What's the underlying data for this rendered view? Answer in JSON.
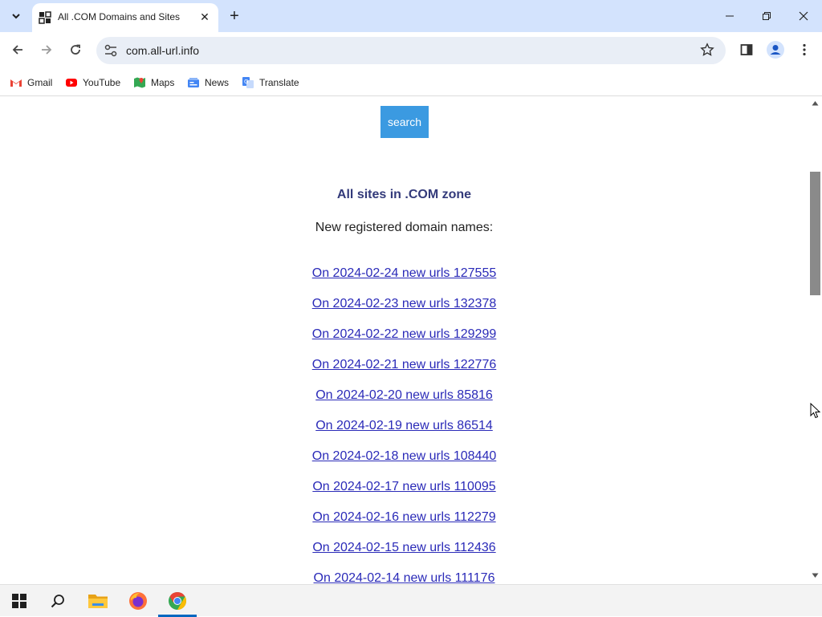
{
  "browser": {
    "tab": {
      "title": "All .COM Domains and Sites",
      "close": "✕"
    },
    "new_tab": "+",
    "window": {
      "minimize": "—",
      "restore": "❐",
      "close": "✕"
    },
    "url": "com.all-url.info"
  },
  "bookmarks": [
    {
      "label": "Gmail",
      "icon": "gmail-icon",
      "color": "#ea4335"
    },
    {
      "label": "YouTube",
      "icon": "youtube-icon",
      "color": "#ff0000"
    },
    {
      "label": "Maps",
      "icon": "maps-icon",
      "color": "#34a853"
    },
    {
      "label": "News",
      "icon": "news-icon",
      "color": "#4285f4"
    },
    {
      "label": "Translate",
      "icon": "translate-icon",
      "color": "#4285f4"
    }
  ],
  "page": {
    "search_button": "search",
    "heading": "All sites in .COM zone",
    "subheading": "New registered domain names:",
    "links": [
      "On 2024-02-24 new urls 127555",
      "On 2024-02-23 new urls 132378",
      "On 2024-02-22 new urls 129299",
      "On 2024-02-21 new urls 122776",
      "On 2024-02-20 new urls 85816",
      "On 2024-02-19 new urls 86514",
      "On 2024-02-18 new urls 108440",
      "On 2024-02-17 new urls 110095",
      "On 2024-02-16 new urls 112279",
      "On 2024-02-15 new urls 112436",
      "On 2024-02-14 new urls 111176"
    ]
  },
  "taskbar": {
    "items": [
      "start-icon",
      "search-icon",
      "file-explorer-icon",
      "firefox-icon",
      "chrome-icon"
    ]
  },
  "colors": {
    "accent": "#3b9ae1",
    "heading": "#333a7a",
    "link": "#2a2ab8"
  }
}
